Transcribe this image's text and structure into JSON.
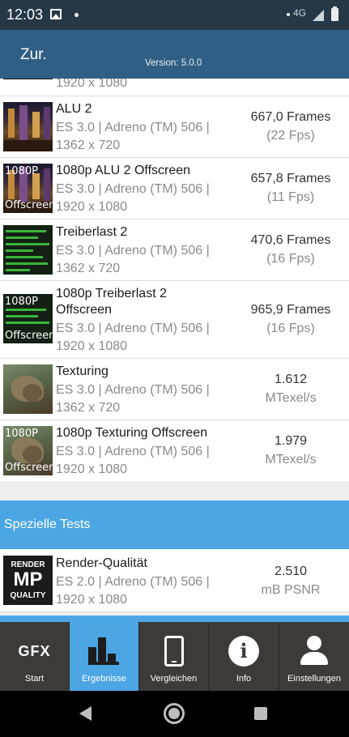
{
  "status_bar": {
    "time": "12:03",
    "network": "4G"
  },
  "app_bar": {
    "back_label": "Zur.",
    "version": "Version: 5.0.0"
  },
  "partial_row": {
    "sub": "1920 x 1080"
  },
  "tests": [
    {
      "title": "ALU 2",
      "sub1": "ES 3.0 | Adreno (TM) 506 |",
      "sub2": "1362 x 720",
      "result": "667,0 Frames",
      "detail": "(22 Fps)"
    },
    {
      "title": "1080p ALU 2 Offscreen",
      "sub1": "ES 3.0 | Adreno (TM) 506 |",
      "sub2": "1920 x 1080",
      "result": "657,8 Frames",
      "detail": "(11 Fps)",
      "thumb_top": "1080P",
      "thumb_bottom": "Offscreen"
    },
    {
      "title": "Treiberlast 2",
      "sub1": "ES 3.0 | Adreno (TM) 506 |",
      "sub2": "1362 x 720",
      "result": "470,6 Frames",
      "detail": "(16 Fps)"
    },
    {
      "title": "1080p Treiberlast 2",
      "title2": "Offscreen",
      "sub1": "ES 3.0 | Adreno (TM) 506 |",
      "sub2": "1920 x 1080",
      "result": "965,9 Frames",
      "detail": "(16 Fps)",
      "thumb_top": "1080P",
      "thumb_bottom": "Offscreen"
    },
    {
      "title": "Texturing",
      "sub1": "ES 3.0 | Adreno (TM) 506 |",
      "sub2": "1362 x 720",
      "result": "1.612",
      "detail": "MTexel/s"
    },
    {
      "title": "1080p Texturing Offscreen",
      "sub1": "ES 3.0 | Adreno (TM) 506 |",
      "sub2": "1920 x 1080",
      "result": "1.979",
      "detail": "MTexel/s",
      "thumb_top": "1080P",
      "thumb_bottom": "Offscreen"
    }
  ],
  "section": {
    "label": "Spezielle Tests"
  },
  "special_tests": [
    {
      "title": "Render-Qualität",
      "sub1": "ES 2.0 | Adreno (TM) 506 |",
      "sub2": "1920 x 1080",
      "result": "2.510",
      "detail": "mB PSNR",
      "thumb_line1": "RENDER",
      "thumb_line2": "MP",
      "thumb_line3": "QUALITY"
    }
  ],
  "bottom_nav": [
    {
      "label": "Start",
      "icon": "gfx-logo-icon",
      "icon_text": "GFX"
    },
    {
      "label": "Ergebnisse",
      "icon": "bar-chart-icon",
      "active": true
    },
    {
      "label": "Vergleichen",
      "icon": "phone-icon"
    },
    {
      "label": "Info",
      "icon": "info-icon",
      "icon_text": "i"
    },
    {
      "label": "Einstellungen",
      "icon": "user-icon"
    }
  ],
  "colors": {
    "status_bar": "#263746",
    "app_bar": "#2f5f85",
    "accent": "#4ca6e4",
    "bottom_nav": "#3d3a38"
  }
}
